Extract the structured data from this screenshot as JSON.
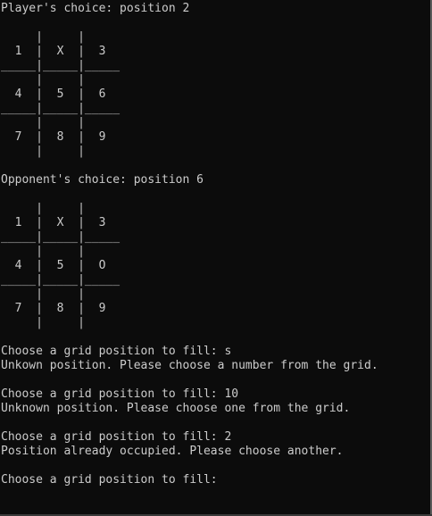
{
  "terminal": {
    "lines": [
      "Player's choice: position 2",
      "",
      "     |     |",
      "  1  |  X  |  3",
      "_____|_____|_____",
      "     |     |",
      "  4  |  5  |  6",
      "_____|_____|_____",
      "     |     |",
      "  7  |  8  |  9",
      "     |     |",
      "",
      "Opponent's choice: position 6",
      "",
      "     |     |",
      "  1  |  X  |  3",
      "_____|_____|_____",
      "     |     |",
      "  4  |  5  |  O",
      "_____|_____|_____",
      "     |     |",
      "  7  |  8  |  9",
      "     |     |",
      "",
      "Choose a grid position to fill: s",
      "Unkown position. Please choose a number from the grid.",
      "",
      "Choose a grid position to fill: 10",
      "Unknown position. Please choose one from the grid.",
      "",
      "Choose a grid position to fill: 2",
      "Position already occupied. Please choose another.",
      "",
      "Choose a grid position to fill:"
    ]
  }
}
